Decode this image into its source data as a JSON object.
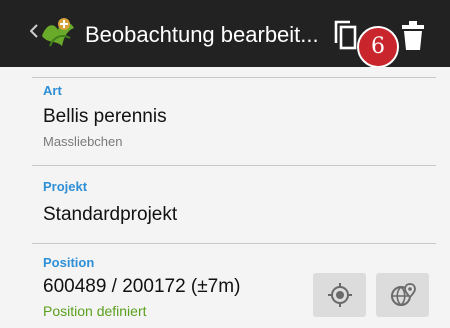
{
  "appbar": {
    "title": "Beobachtung bearbeit...",
    "icons": {
      "back": "chevron-left-icon",
      "logo": "app-logo-icon",
      "copy": "copy-icon",
      "delete": "trash-icon"
    },
    "badge": "6"
  },
  "form": {
    "art": {
      "label": "Art",
      "value": "Bellis perennis",
      "sub": "Massliebchen"
    },
    "projekt": {
      "label": "Projekt",
      "value": "Standardprojekt"
    },
    "position": {
      "label": "Position",
      "value": "600489 / 200172 (±7m)",
      "status": "Position definiert"
    }
  },
  "colors": {
    "appbar": "#222222",
    "accent": "#2e8fd6",
    "status_ok": "#5aa01e",
    "badge": "#c8262c"
  }
}
